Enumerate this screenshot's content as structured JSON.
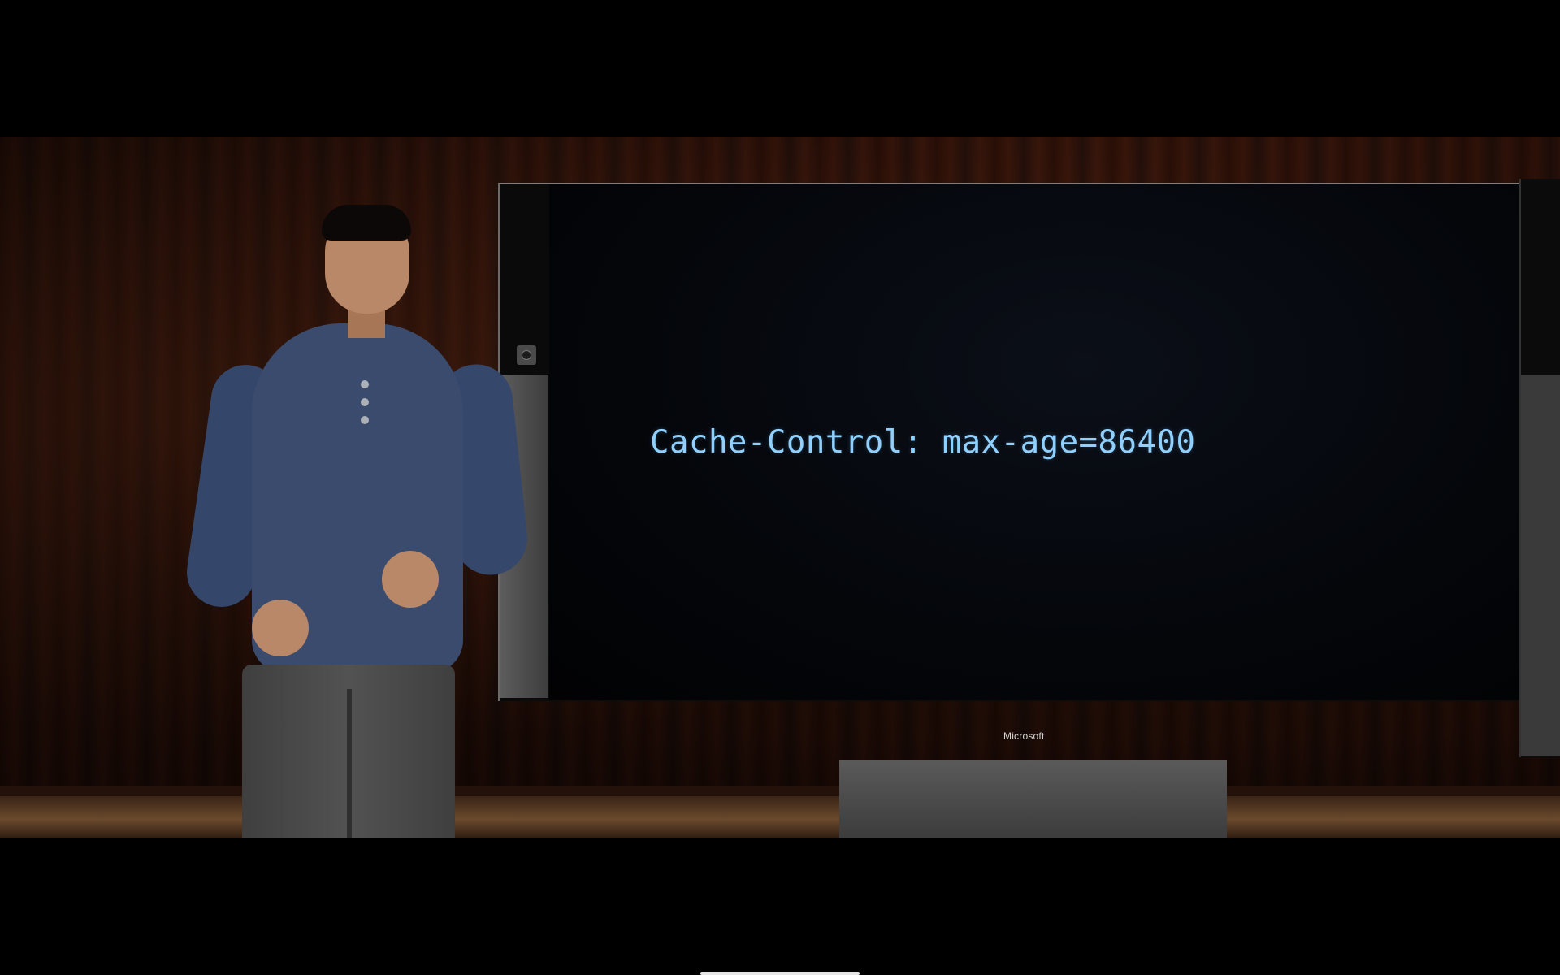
{
  "slide": {
    "code": "Cache-Control: max-age=86400"
  },
  "monitor": {
    "brand": "Microsoft"
  },
  "icons": {
    "camera": "camera-icon"
  }
}
